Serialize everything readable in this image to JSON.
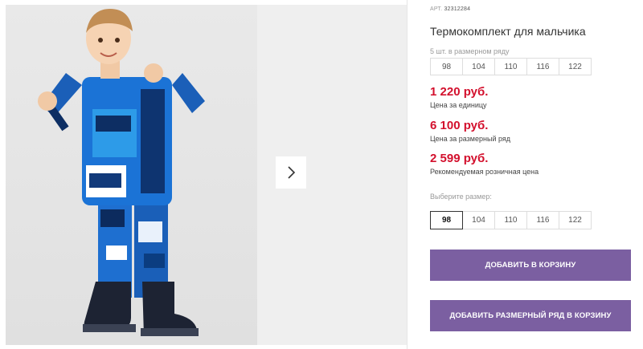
{
  "product": {
    "article_label": "АРТ.",
    "article_number": "32312284",
    "title": "Термокомплект для мальчика",
    "series_note": "5 шт. в размерном ряду"
  },
  "size_series": [
    "98",
    "104",
    "110",
    "116",
    "122"
  ],
  "prices": {
    "unit_price": "1 220 руб.",
    "unit_label": "Цена за единицу",
    "series_price": "6 100 руб.",
    "series_label": "Цена за размерный ряд",
    "retail_price": "2 599 руб.",
    "retail_label": "Рекомендуемая розничная цена",
    "price_color": "#d3102d"
  },
  "size_picker": {
    "label": "Выберите размер:",
    "options": [
      "98",
      "104",
      "110",
      "116",
      "122"
    ],
    "selected": "98"
  },
  "actions": {
    "add_to_cart": "ДОБАВИТЬ В КОРЗИНУ",
    "add_series_to_cart": "ДОБАВИТЬ РАЗМЕРНЫЙ РЯД В КОРЗИНУ",
    "button_color": "#7b5fa1"
  },
  "gallery": {
    "next_icon": "chevron-right-icon",
    "photo": "product-photo"
  }
}
